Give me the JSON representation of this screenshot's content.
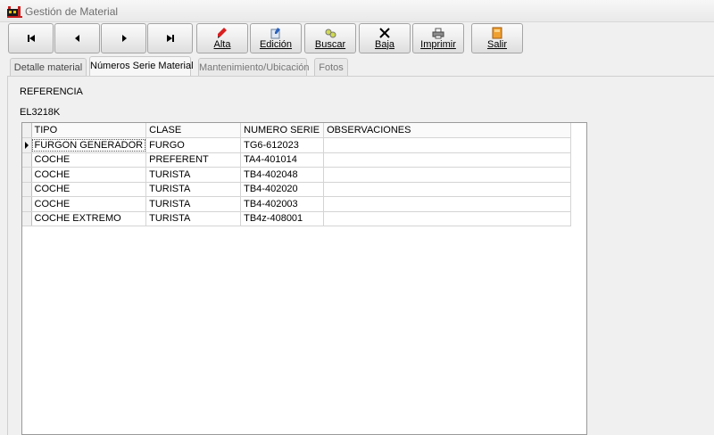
{
  "window": {
    "title": "Gestión de Material"
  },
  "toolbar": {
    "nav": [
      {
        "name": "first-record-button",
        "glyph": "⏮"
      },
      {
        "name": "prev-record-button",
        "glyph": "◀"
      },
      {
        "name": "next-record-button",
        "glyph": "▶"
      },
      {
        "name": "last-record-button",
        "glyph": "⏭"
      }
    ],
    "alta_label": "Alta",
    "edicion_label": "Edición",
    "buscar_label": "Buscar",
    "baja_label": "Baja",
    "imprimir_label": "Imprimir",
    "salir_label": "Salir"
  },
  "tabs": [
    {
      "label": "Detalle material"
    },
    {
      "label": "Números Serie Material",
      "active": true
    },
    {
      "label": "Mantenimiento/Ubicación"
    },
    {
      "label": "Fotos"
    }
  ],
  "referencia": {
    "label": "REFERENCIA",
    "value": "EL3218K"
  },
  "grid": {
    "columns": [
      "TIPO",
      "CLASE",
      "NUMERO SERIE",
      "OBSERVACIONES"
    ],
    "rows": [
      [
        "FURGON GENERADOR",
        "FURGO",
        "TG6-612023",
        ""
      ],
      [
        "COCHE",
        "PREFERENT",
        "TA4-401014",
        ""
      ],
      [
        "COCHE",
        "TURISTA",
        "TB4-402048",
        ""
      ],
      [
        "COCHE",
        "TURISTA",
        "TB4-402020",
        ""
      ],
      [
        "COCHE",
        "TURISTA",
        "TB4-402003",
        ""
      ],
      [
        "COCHE EXTREMO",
        "TURISTA",
        "TB4z-408001",
        ""
      ]
    ]
  }
}
